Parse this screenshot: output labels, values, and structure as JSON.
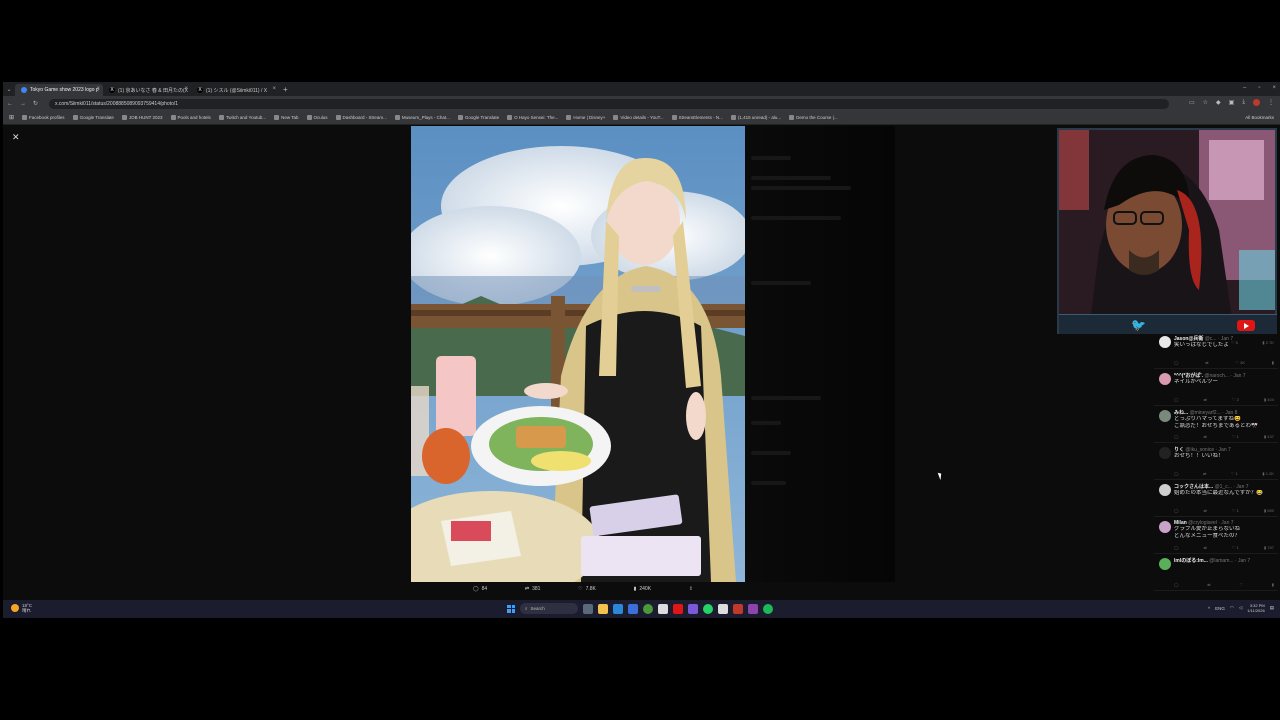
{
  "browser": {
    "tabs": [
      {
        "label": "Tokyo Game show 2023 logo p",
        "color": "#4285f4",
        "active": true
      },
      {
        "label": "(1) 京あいなさ 春 & 田月たの(X",
        "color": "#ffffff",
        "active": false
      },
      {
        "label": "(1) シスル (@Siimki011) / X",
        "color": "#ffffff",
        "active": false
      }
    ],
    "new_tab": "+",
    "url": "x.com/Siimki011/status/2008885089093759414/photo/1",
    "bookmarks": [
      "Facebook profiles",
      "Google Translate",
      "JOB HUNT 2023",
      "Pools and hotels",
      "Twitch and Youtub...",
      "New Tab",
      "Oculus",
      "Dashboard - Stream...",
      "Museum_Plays - Chat...",
      "Google Translate",
      "O Hayo Sensei: The...",
      "Home | Disney+",
      "Video details - YouT...",
      "StreamElements - N...",
      "(1,415 unread) - alu...",
      "Demo the Course |..."
    ],
    "all_bookmarks": "All Bookmarks"
  },
  "post": {
    "close": "✕",
    "actions": {
      "replies": "84",
      "reposts": "381",
      "likes": "7.8K",
      "views": "240K"
    }
  },
  "replies": [
    {
      "name": "Jason@兵衛",
      "handle": "@c... · Jan 7",
      "text": "笑いっぱなしでしたよ",
      "stats": [
        "",
        "",
        "3K",
        ""
      ],
      "color": "#e8e8e8"
    },
    {
      "name": "*^^(*おがぱ'.",
      "handle": "@naroch... · Jan 7",
      "text": "ネイルがベルツー",
      "stats": [
        "",
        "",
        "2",
        "404"
      ],
      "color": "#d99ab0"
    },
    {
      "name": "みね...",
      "handle": "@mineyarf2... · Jan 8",
      "text": "どっぷりハマってますね😆",
      "text2": "ご執恋だ！おせちまであるとわ🎌",
      "stats": [
        "",
        "",
        "1",
        "437"
      ],
      "color": "#7a8a7a"
    },
    {
      "name": "りく",
      "handle": "@iku_sonice · Jan 7",
      "text": "おせち！！いいね！",
      "stats": [
        "",
        "",
        "1",
        "1.2K"
      ],
      "color": "#222222"
    },
    {
      "name": "コックさんは本...",
      "handle": "@1_c... · Jan 7",
      "text": "始めたの本当に最近なんですか？😂",
      "stats": [
        "",
        "",
        "1",
        "580"
      ],
      "color": "#cfcfcf"
    },
    {
      "name": "Milan",
      "handle": "@crylogiseel · Jan 7",
      "text": "グラブル愛が止まらないね",
      "text2": "どんなメニュー食べたの？",
      "stats": [
        "",
        "",
        "1",
        "787"
      ],
      "color": "#c8a2c8"
    },
    {
      "name": "lmlのぼる:lm...",
      "handle": "@lamam... · Jan 7",
      "text": "",
      "stats": [
        "",
        "",
        "",
        ""
      ],
      "color": "#5ab05a"
    }
  ],
  "reply_top_stats": [
    "",
    "",
    "6",
    "2.7K"
  ],
  "taskbar": {
    "weather_temp": "18°C",
    "weather_desc": "晴れ",
    "search": "Search",
    "lang": "ENG",
    "time": "3:32 PM",
    "date": "1/11/2026"
  },
  "colors": {
    "twitter_blue": "#3fb2f0",
    "youtube_red": "#e01515",
    "taskbar_bg": "#1b1d2e"
  },
  "icons": [
    "reply-icon",
    "repost-icon",
    "like-icon",
    "views-icon",
    "share-icon",
    "twitter-logo-icon",
    "youtube-logo-icon",
    "windows-start-icon",
    "search-icon"
  ]
}
